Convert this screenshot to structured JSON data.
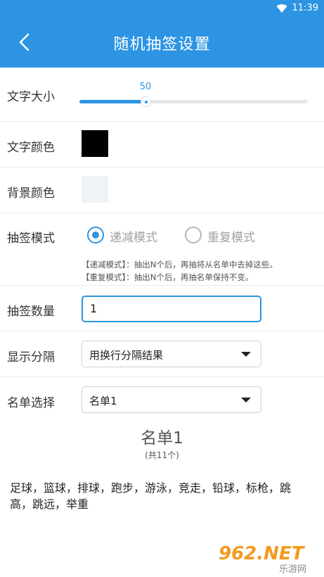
{
  "status_bar": {
    "time": "11:39"
  },
  "header": {
    "title": "随机抽签设置"
  },
  "settings": {
    "font_size": {
      "label": "文字大小",
      "value": 50,
      "value_text": "50",
      "fill_fraction": 0.29
    },
    "text_color": {
      "label": "文字颜色",
      "color": "#000000"
    },
    "bg_color": {
      "label": "背景颜色",
      "color": "#eef3f8"
    },
    "draw_mode": {
      "label": "抽签模式",
      "options": [
        {
          "label": "递减模式",
          "selected": true
        },
        {
          "label": "重复模式",
          "selected": false
        }
      ],
      "notes": [
        "【递减模式】：抽出N个后，再抽将从名单中去掉这些。",
        "【重复模式】：抽出N个后，再抽名单保持不变。"
      ]
    },
    "draw_count": {
      "label": "抽签数量",
      "value": "1"
    },
    "separator": {
      "label": "显示分隔",
      "selected": "用换行分隔结果"
    },
    "list_select": {
      "label": "名单选择",
      "selected": "名单1"
    }
  },
  "list": {
    "title": "名单1",
    "count": "(共11个)",
    "content": "足球，篮球，排球，跑步，游泳，竞走，铅球，标枪，跳高，跳远，举重"
  },
  "watermark": {
    "text": "962.NET",
    "subtext": "乐游网"
  },
  "colors": {
    "accent": "#2c94e3"
  }
}
